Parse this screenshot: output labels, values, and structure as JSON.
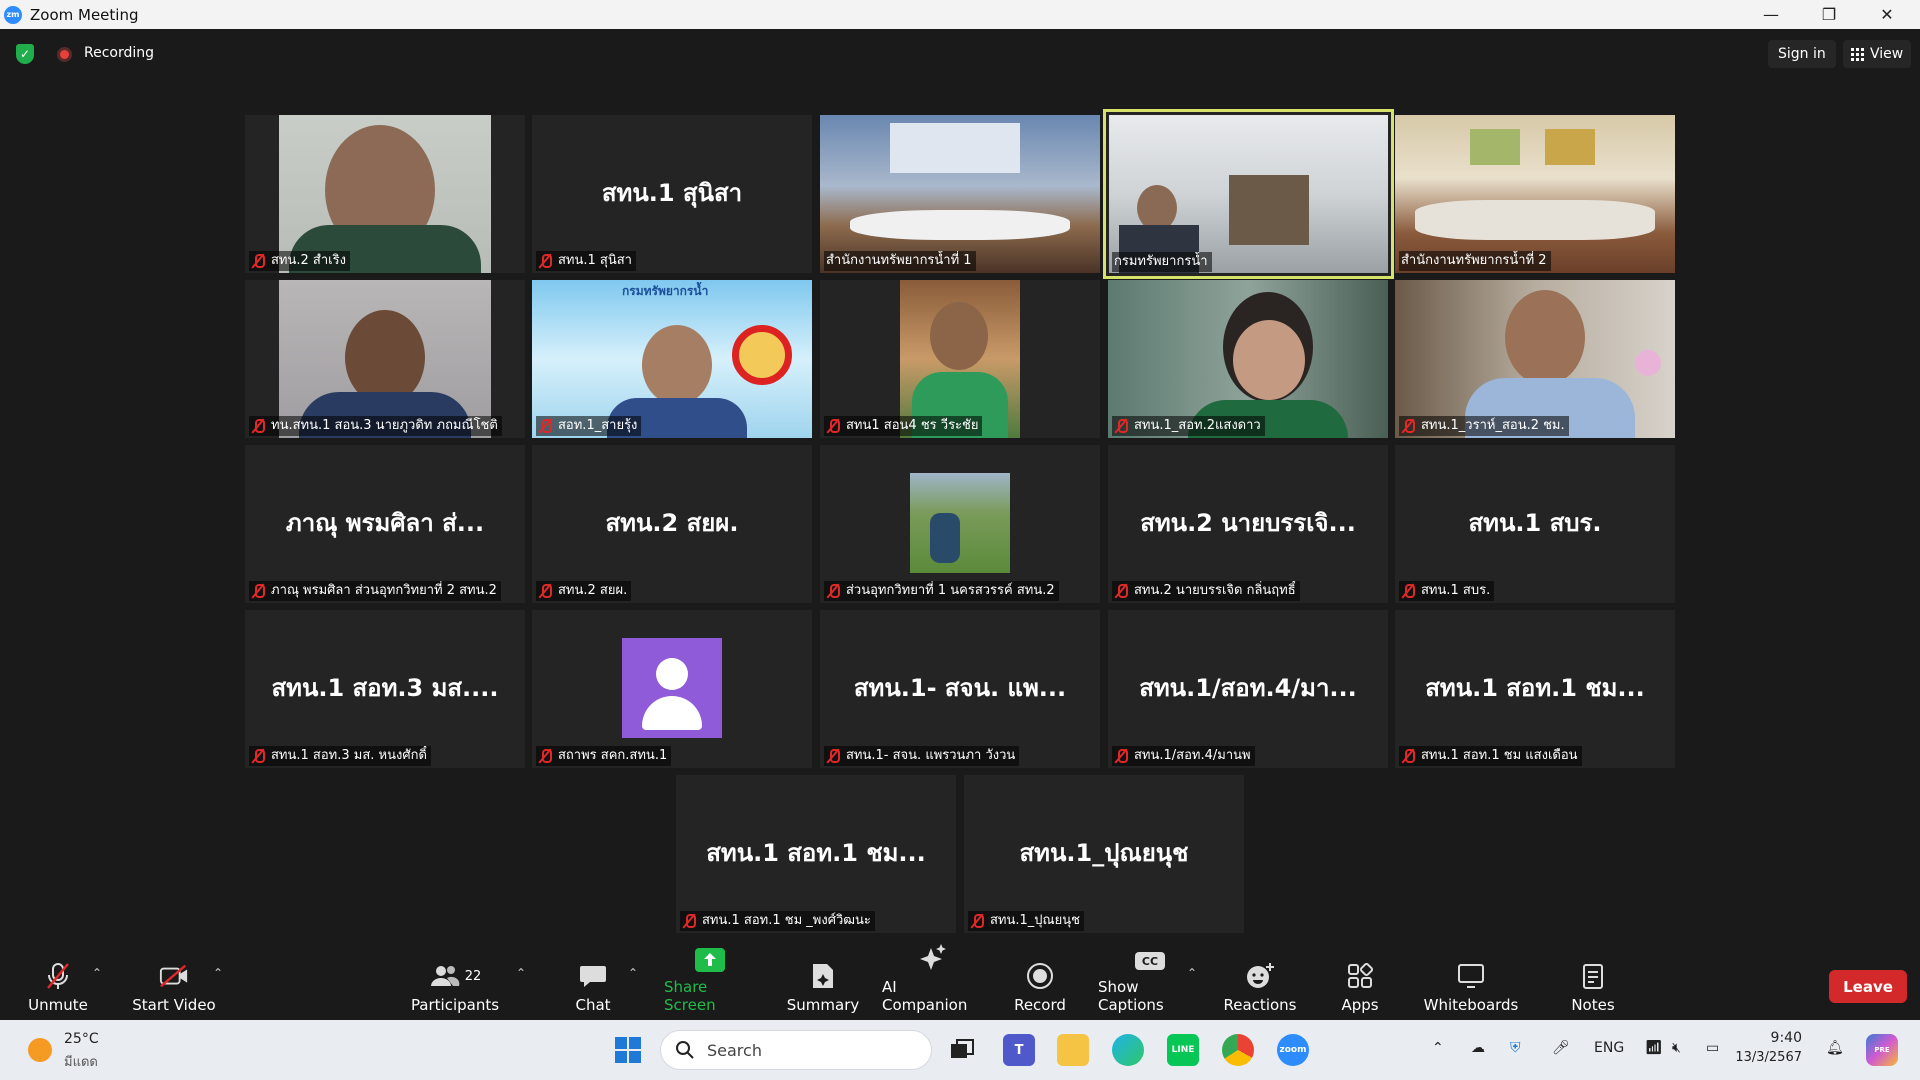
{
  "window": {
    "title": "Zoom Meeting",
    "app_icon_text": "zm",
    "minimize": "—",
    "restore": "❐",
    "close": "✕"
  },
  "topbar": {
    "recording_label": "Recording",
    "signin_label": "Sign in",
    "view_label": "View"
  },
  "tiles": [
    {
      "label": "สทน.2 สำเริง",
      "big": ""
    },
    {
      "label": "สทน.1 สุนิสา",
      "big": "สทน.1 สุนิสา"
    },
    {
      "label": "สำนักงานทรัพยากรน้ำที่ 1",
      "big": ""
    },
    {
      "label": "กรมทรัพยากรน้ำ",
      "big": ""
    },
    {
      "label": "สำนักงานทรัพยากรน้ำที่ 2",
      "big": ""
    },
    {
      "label": "ทน.สทน.1 สอน.3 นายภูวดิท ภถมณีโชติ",
      "big": ""
    },
    {
      "label": "สอท.1_สายรุ้ง",
      "big": "",
      "banner": "กรมทรัพยากรน้ำ"
    },
    {
      "label": "สทน1 สอน4 ชร วีระชัย",
      "big": ""
    },
    {
      "label": "สทน.1_สอท.2แสงดาว",
      "big": ""
    },
    {
      "label": "สทน.1_วราห์_สอน.2 ชม.",
      "big": ""
    },
    {
      "label": "ภาณุ  พรมศิลา ส่วนอุทกวิทยาที่ 2 สทน.2",
      "big": "ภาณุ  พรมศิลา ส่..."
    },
    {
      "label": "สทน.2 สยผ.",
      "big": "สทน.2 สยผ."
    },
    {
      "label": "ส่วนอุทกวิทยาที่ 1 นครสวรรค์ สทน.2",
      "big": ""
    },
    {
      "label": "สทน.2 นายบรรเจิด กลิ่นฤทธิ์",
      "big": "สทน.2 นายบรรเจิ..."
    },
    {
      "label": "สทน.1 สบร.",
      "big": "สทน.1 สบร."
    },
    {
      "label": "สทน.1 สอท.3 มส. หนงศักดิ์",
      "big": "สทน.1 สอท.3 มส...."
    },
    {
      "label": "สถาพร สคก.สทน.1",
      "big": ""
    },
    {
      "label": "สทน.1- สจน. แพรวนภา วังวน",
      "big": "สทน.1- สจน. แพ..."
    },
    {
      "label": "สทน.1/สอท.4/มานพ",
      "big": "สทน.1/สอท.4/มา..."
    },
    {
      "label": "สทน.1 สอท.1 ชม แสงเดือน",
      "big": "สทน.1 สอท.1 ชม..."
    },
    {
      "label": "สทน.1 สอท.1 ชม _พงศ์วิฒนะ",
      "big": "สทน.1 สอท.1 ชม..."
    },
    {
      "label": "สทน.1_ปุณยนุช",
      "big": "สทน.1_ปุณยนุช"
    }
  ],
  "toolbar": {
    "unmute": "Unmute",
    "start_video": "Start Video",
    "participants": "Participants",
    "participants_count": "22",
    "chat": "Chat",
    "share_screen": "Share Screen",
    "summary": "Summary",
    "ai_companion": "AI Companion",
    "record": "Record",
    "show_captions": "Show Captions",
    "captions_icon": "CC",
    "reactions": "Reactions",
    "apps": "Apps",
    "whiteboards": "Whiteboards",
    "notes": "Notes",
    "leave": "Leave"
  },
  "taskbar": {
    "temperature": "25°C",
    "weather": "มีแดด",
    "search_placeholder": "Search",
    "language": "ENG",
    "time": "9:40",
    "date": "13/3/2567",
    "teams_icon_text": "T",
    "line_icon_text": "LINE",
    "zoom_icon_text": "zoom",
    "copilot_icon_text": "PRE"
  },
  "colors": {
    "accent": "#2d8cff",
    "leave": "#d4292b",
    "share": "#1fbc4a",
    "speaker_border": "#d5e36a",
    "mute": "#e02828"
  }
}
